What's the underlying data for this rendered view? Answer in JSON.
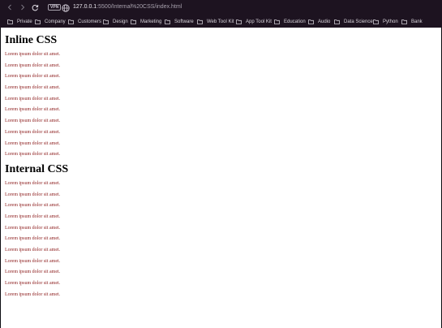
{
  "browser": {
    "vpn_badge": "VPN",
    "url_host": "127.0.0.1",
    "url_path": ":5500/Internal%20CSS/index.html",
    "bookmarks": [
      {
        "label": "Private"
      },
      {
        "label": "Company"
      },
      {
        "label": "Customers"
      },
      {
        "label": "Design"
      },
      {
        "label": "Marketing"
      },
      {
        "label": "Software"
      },
      {
        "label": "Web Tool Kit"
      },
      {
        "label": "App Tool Kit"
      },
      {
        "label": "Education"
      },
      {
        "label": "Audio"
      },
      {
        "label": "Data Science"
      },
      {
        "label": "Python"
      },
      {
        "label": "Bank"
      }
    ],
    "icons": {
      "back": "back-arrow-icon",
      "forward": "forward-arrow-icon",
      "reload": "reload-icon",
      "site": "globe-icon",
      "bookmark": "folder-icon"
    }
  },
  "page": {
    "sections": [
      {
        "heading": "Inline CSS",
        "text_color": "#8b1a1a",
        "paragraphs": [
          "Lorem ipsum dolor sit amet.",
          "Lorem ipsum dolor sit amet.",
          "Lorem ipsum dolor sit amet.",
          "Lorem ipsum dolor sit amet.",
          "Lorem ipsum dolor sit amet.",
          "Lorem ipsum dolor sit amet.",
          "Lorem ipsum dolor sit amet.",
          "Lorem ipsum dolor sit amet.",
          "Lorem ipsum dolor sit amet.",
          "Lorem ipsum dolor sit amet."
        ]
      },
      {
        "heading": "Internal CSS",
        "text_color": "#8b1a1a",
        "paragraphs": [
          "Lorem ipsum dolor sit amet.",
          "Lorem ipsum dolor sit amet.",
          "Lorem ipsum dolor sit amet.",
          "Lorem ipsum dolor sit amet.",
          "Lorem ipsum dolor sit amet.",
          "Lorem ipsum dolor sit amet.",
          "Lorem ipsum dolor sit amet.",
          "Lorem ipsum dolor sit amet.",
          "Lorem ipsum dolor sit amet.",
          "Lorem ipsum dolor sit amet.",
          "Lorem ipsum dolor sit amet."
        ]
      }
    ]
  }
}
